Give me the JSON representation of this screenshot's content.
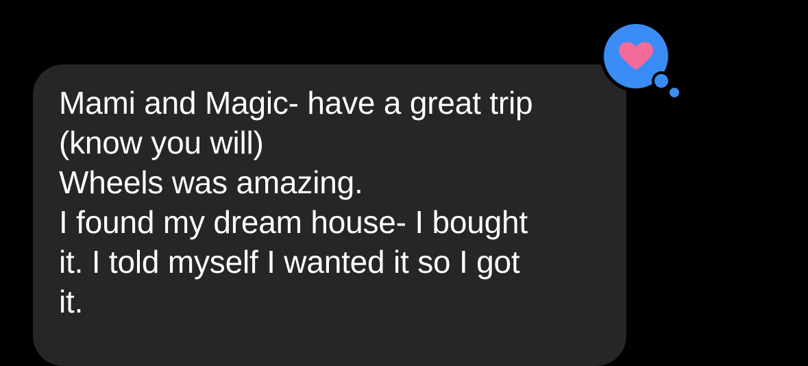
{
  "message": {
    "sender": "other",
    "lines": [
      "Mami and Magic- have a great trip",
      "(know you will)",
      "Wheels was amazing.",
      "I found my dream house- I bought",
      "it. I told myself I wanted it so I got",
      "it."
    ]
  },
  "tapback": {
    "icon": "heart-icon",
    "bubble_color": "#3a8cf5",
    "heart_color": "#f26b9a"
  },
  "colors": {
    "background": "#000000",
    "bubble": "#262628",
    "text": "#ffffff"
  }
}
